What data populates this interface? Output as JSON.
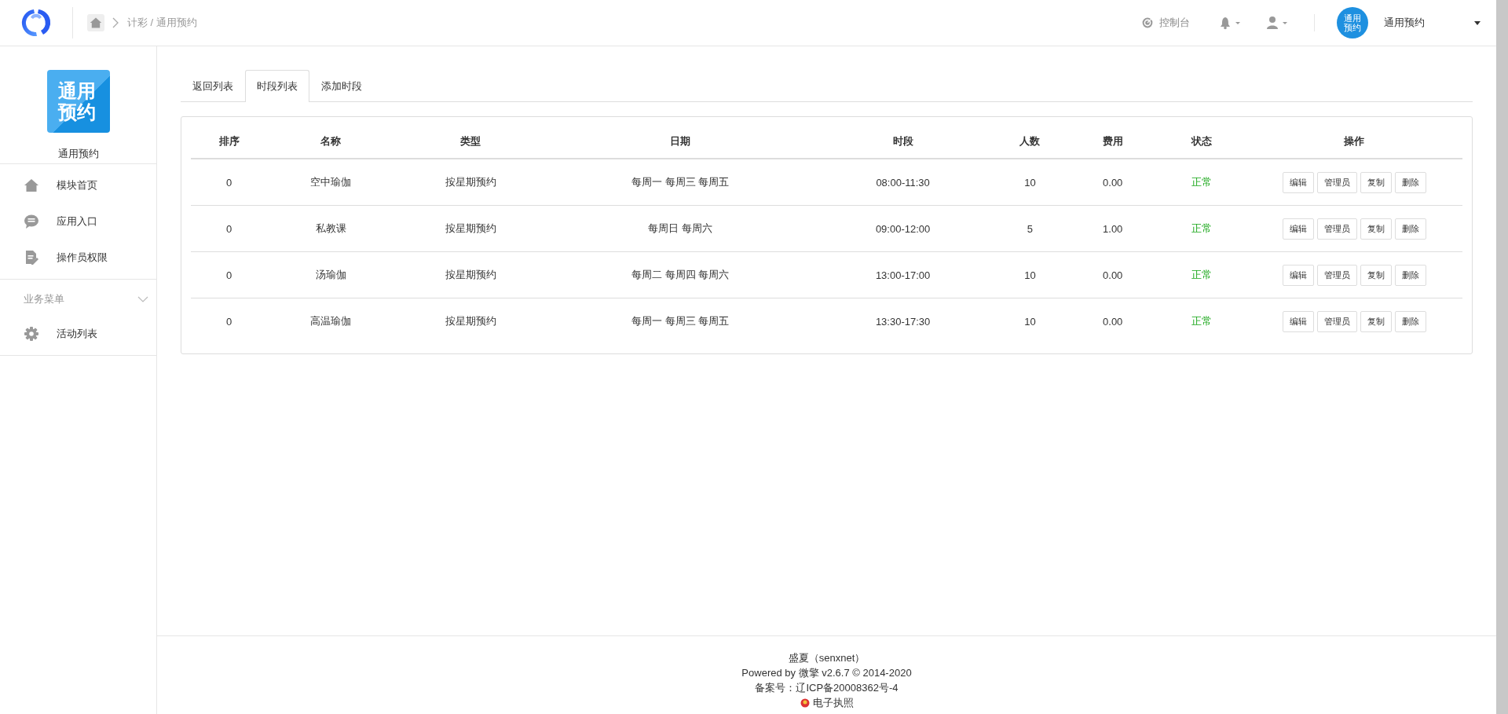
{
  "header": {
    "breadcrumb": "计彩 / 通用预约",
    "console_link": "控制台",
    "account": {
      "avatar_text": "通用预约",
      "name": "通用预约"
    }
  },
  "sidebar": {
    "module": {
      "logo_text": "通用预约",
      "name": "通用预约"
    },
    "items": [
      {
        "kind": "home",
        "label": "模块首页"
      },
      {
        "kind": "chat",
        "label": "应用入口"
      },
      {
        "kind": "doc",
        "label": "操作员权限"
      }
    ],
    "sections": [
      {
        "title": "业务菜单",
        "expanded": true,
        "items": [
          {
            "kind": "gear",
            "label": "活动列表"
          }
        ]
      }
    ]
  },
  "tabs": [
    {
      "label": "返回列表",
      "selected": false
    },
    {
      "label": "时段列表",
      "selected": true
    },
    {
      "label": "添加时段",
      "selected": false
    }
  ],
  "table": {
    "columns": [
      "排序",
      "名称",
      "类型",
      "日期",
      "时段",
      "人数",
      "费用",
      "状态",
      "操作"
    ],
    "rows": [
      {
        "cells": [
          "0",
          "空中瑜伽",
          "按星期预约",
          "每周一 每周三 每周五",
          "08:00-11:30",
          "10",
          "0.00"
        ],
        "status": "正常",
        "actions": [
          "编辑",
          "管理员",
          "复制",
          "删除"
        ]
      },
      {
        "cells": [
          "0",
          "私教课",
          "按星期预约",
          "每周日 每周六",
          "09:00-12:00",
          "5",
          "1.00"
        ],
        "status": "正常",
        "actions": [
          "编辑",
          "管理员",
          "复制",
          "删除"
        ]
      },
      {
        "cells": [
          "0",
          "汤瑜伽",
          "按星期预约",
          "每周二 每周四 每周六",
          "13:00-17:00",
          "10",
          "0.00"
        ],
        "status": "正常",
        "actions": [
          "编辑",
          "管理员",
          "复制",
          "删除"
        ]
      },
      {
        "cells": [
          "0",
          "高温瑜伽",
          "按星期预约",
          "每周一 每周三 每周五",
          "13:30-17:30",
          "10",
          "0.00"
        ],
        "status": "正常",
        "actions": [
          "编辑",
          "管理员",
          "复制",
          "删除"
        ]
      }
    ]
  },
  "footer": {
    "lines": [
      "盛夏（senxnet）",
      "Powered by 微擎 v2.6.7 © 2014-2020",
      "备案号：辽ICP备20008362号-4"
    ],
    "license_link": "电子执照"
  }
}
